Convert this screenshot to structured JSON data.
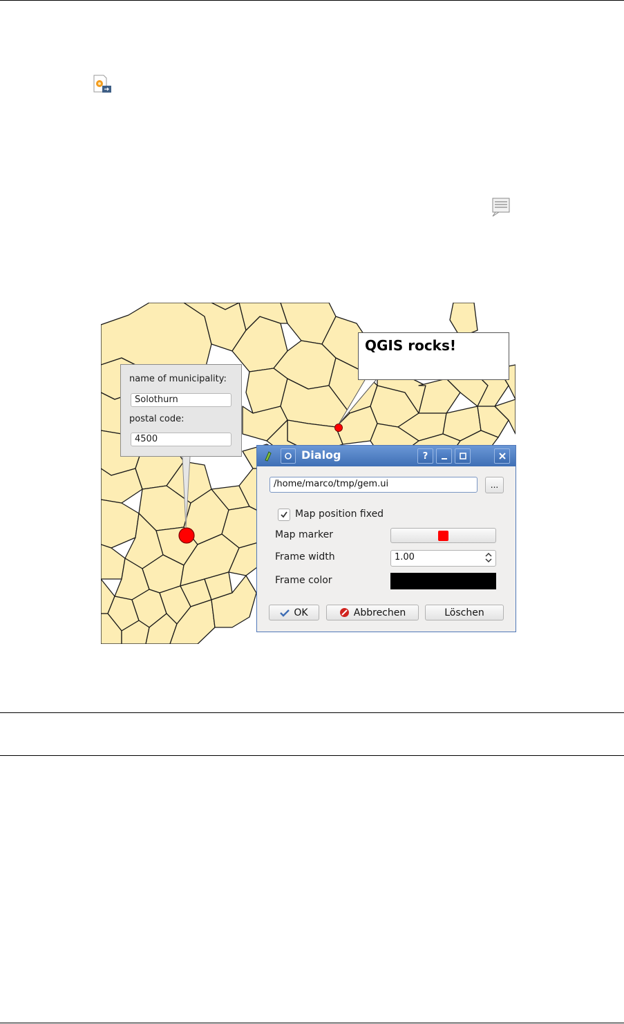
{
  "toolbar_icons": {
    "form_annotation_icon": "form-annotation-icon",
    "text_annotation_icon": "text-annotation-icon"
  },
  "form_annotation": {
    "field1_label": "name of municipality:",
    "field1_value": "Solothurn",
    "field2_label": "postal code:",
    "field2_value": "4500"
  },
  "text_annotation": {
    "text": "QGIS rocks!"
  },
  "dialog": {
    "title": "Dialog",
    "help_button": "?",
    "file_path": "/home/marco/tmp/gem.ui",
    "browse_button": "...",
    "map_position_fixed_label": "Map position fixed",
    "map_position_fixed_checked": true,
    "map_marker_label": "Map marker",
    "frame_width_label": "Frame width",
    "frame_width_value": "1.00",
    "frame_color_label": "Frame color",
    "ok_button": "OK",
    "cancel_button": "Abbrechen",
    "delete_button": "Löschen"
  },
  "colors": {
    "map_fill": "#fdedb4",
    "marker": "#ff0000",
    "frame_color": "#000000",
    "titlebar": "#4f7fc3"
  }
}
